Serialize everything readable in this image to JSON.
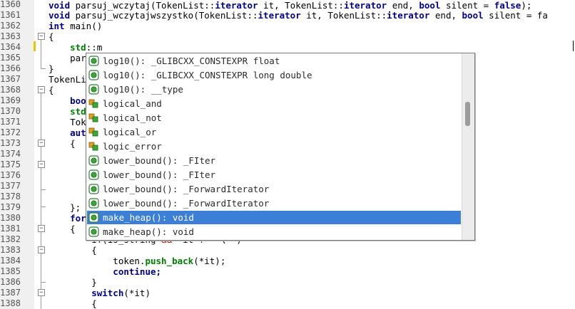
{
  "gutter": {
    "line_numbers": [
      "1360",
      "1361",
      "1362",
      "1363",
      "1364",
      "1365",
      "1366",
      "1367",
      "1368",
      "1369",
      "1370",
      "1371",
      "1372",
      "1373",
      "1374",
      "1375",
      "1376",
      "1377",
      "1378",
      "1379",
      "1380",
      "1381",
      "1382",
      "1383",
      "1384",
      "1385",
      "1386",
      "1387",
      "1388"
    ]
  },
  "code": {
    "l1360": {
      "a": "void",
      "b": " parsuj_wczytaj(TokenList::",
      "c": "iterator",
      "d": " it, TokenList::",
      "e": "iterator",
      "f": " end, ",
      "g": "bool",
      "h": " silent = ",
      "i": "false",
      "j": ");"
    },
    "l1361": {
      "a": "void",
      "b": " parsuj_wczytajwszystko(TokenList::",
      "c": "iterator",
      "d": " it, TokenList::",
      "e": "iterator",
      "f": " end, ",
      "g": "bool",
      "h": " silent = fa"
    },
    "l1362": {
      "a": "int",
      "b": " main()"
    },
    "l1363": "{",
    "l1364": {
      "a": "    std",
      "b": "::m"
    },
    "l1365": "    par",
    "l1366": "}",
    "l1367": "TokenLi",
    "l1368": "{",
    "l1369": "    boo",
    "l1370": "    std",
    "l1371": "    Tok",
    "l1372": "    aut",
    "l1373": "    {",
    "l1379": "    };",
    "l1380": "    for",
    "l1381": "    {",
    "l1382a": "        if(is_string ",
    "l1382b": "&&",
    "l1382c": " *it != '\\\"')",
    "l1383": "        {",
    "l1384a": "            token.",
    "l1384b": "push_back",
    "l1384c": "(*it);",
    "l1385": "            continue;",
    "l1386": "        }",
    "l1387a": "        switch",
    "l1387b": "(*it)",
    "l1388": "        {"
  },
  "autocomplete": {
    "items": [
      {
        "label": "log10(): _GLIBCXX_CONSTEXPR float",
        "icon": "function-icon"
      },
      {
        "label": "log10(): _GLIBCXX_CONSTEXPR long double",
        "icon": "function-icon"
      },
      {
        "label": "log10(): __type",
        "icon": "function-icon"
      },
      {
        "label": "logical_and",
        "icon": "class-icon"
      },
      {
        "label": "logical_not",
        "icon": "class-icon"
      },
      {
        "label": "logical_or",
        "icon": "class-icon"
      },
      {
        "label": "logic_error",
        "icon": "class-icon"
      },
      {
        "label": "lower_bound(): _FIter",
        "icon": "function-icon"
      },
      {
        "label": "lower_bound(): _FIter",
        "icon": "function-icon"
      },
      {
        "label": "lower_bound(): _ForwardIterator",
        "icon": "function-icon"
      },
      {
        "label": "lower_bound(): _ForwardIterator",
        "icon": "function-icon"
      },
      {
        "label": "make_heap(): void",
        "icon": "function-icon"
      },
      {
        "label": "make_heap(): void",
        "icon": "function-icon"
      }
    ],
    "selected_index": 11,
    "scroll_fraction": 0.3
  },
  "colors": {
    "selection": "#3b7fd6",
    "keyword": "#00008b",
    "method": "#008000",
    "operator": "#c00000"
  }
}
